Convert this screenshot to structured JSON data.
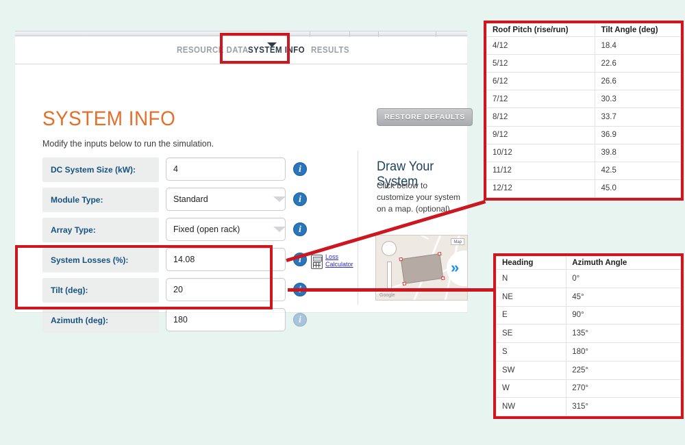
{
  "app": {
    "tabs": [
      {
        "id": "resource",
        "label": "RESOURCE DATA",
        "active": false
      },
      {
        "id": "system",
        "label": "SYSTEM INFO",
        "active": true
      },
      {
        "id": "results",
        "label": "RESULTS",
        "active": false
      }
    ],
    "page_title": "SYSTEM INFO",
    "page_subtitle": "Modify the inputs below to run the simulation.",
    "restore_defaults_label": "RESTORE DEFAULTS"
  },
  "form": {
    "rows": [
      {
        "label": "DC System Size (kW):",
        "value": "4",
        "type": "text"
      },
      {
        "label": "Module Type:",
        "value": "Standard",
        "type": "select"
      },
      {
        "label": "Array Type:",
        "value": "Fixed (open rack)",
        "type": "select"
      },
      {
        "label": "System Losses (%):",
        "value": "14.08",
        "type": "text"
      },
      {
        "label": "Tilt (deg):",
        "value": "20",
        "type": "text"
      },
      {
        "label": "Azimuth (deg):",
        "value": "180",
        "type": "text"
      }
    ],
    "info_icon_glyph": "i",
    "loss_calculator": {
      "line1": "Loss",
      "line2": "Calculator"
    }
  },
  "draw_system": {
    "title": "Draw Your System",
    "description": "Click below to customize your system on a map. (optional)",
    "map_label": "Map",
    "map_credit": "Google",
    "next_glyph": "»"
  },
  "roof_pitch_table": {
    "columns": [
      "Roof Pitch (rise/run)",
      "Tilt Angle (deg)"
    ],
    "rows": [
      [
        "4/12",
        "18.4"
      ],
      [
        "5/12",
        "22.6"
      ],
      [
        "6/12",
        "26.6"
      ],
      [
        "7/12",
        "30.3"
      ],
      [
        "8/12",
        "33.7"
      ],
      [
        "9/12",
        "36.9"
      ],
      [
        "10/12",
        "39.8"
      ],
      [
        "11/12",
        "42.5"
      ],
      [
        "12/12",
        "45.0"
      ]
    ]
  },
  "azimuth_table": {
    "columns": [
      "Heading",
      "Azimuth Angle"
    ],
    "rows": [
      [
        "N",
        "0°"
      ],
      [
        "NE",
        "45°"
      ],
      [
        "E",
        "90°"
      ],
      [
        "SE",
        "135°"
      ],
      [
        "S",
        "180°"
      ],
      [
        "SW",
        "225°"
      ],
      [
        "W",
        "270°"
      ],
      [
        "NW",
        "315°"
      ]
    ]
  },
  "colors": {
    "page_background": "#e7f4ef",
    "annotation_red": "#cc1720",
    "heading_orange": "#e2702a",
    "label_blue": "#17527e",
    "info_blue": "#2a76bd"
  }
}
